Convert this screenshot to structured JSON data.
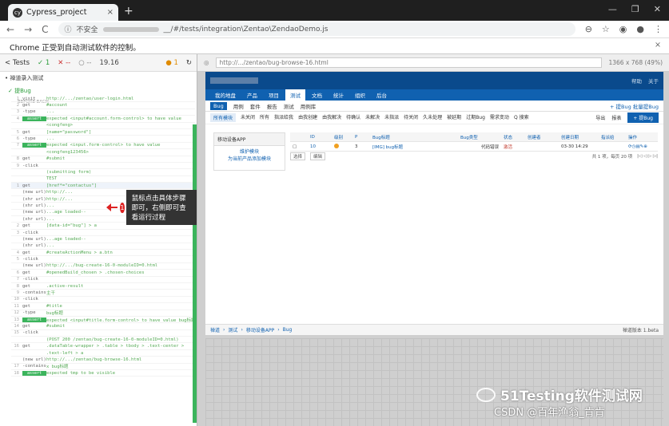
{
  "browser": {
    "tab_title": "Cypress_project",
    "new_tab": "+",
    "window_controls": [
      "—",
      "❐",
      "✕"
    ],
    "not_secure": "不安全",
    "url_path": "__/#/tests/integration\\Zentao\\ZendaoDemo.js",
    "info_bar": "Chrome 正受到自动测试软件的控制。"
  },
  "runner": {
    "tests_label": "< Tests",
    "passed": "1",
    "failed": "--",
    "pending": "--",
    "duration": "19.16",
    "count": "1"
  },
  "suite": {
    "name": "• 禅道录入测试",
    "test": "✓ 提Bug",
    "section": "BEFORE EACH"
  },
  "commands": [
    {
      "n": "1",
      "k": "visit",
      "v": "http://.../zentao/user-login.html"
    },
    {
      "n": "2",
      "k": "get",
      "v": "#account"
    },
    {
      "n": "3",
      "k": "-type",
      "v": "..."
    },
    {
      "n": "4",
      "k": "assert",
      "v": "expected <input#account.form-control> to have value"
    },
    {
      "n": "",
      "k": "",
      "v": "<congfeng>"
    },
    {
      "n": "5",
      "k": "get",
      "v": "[name=\"password\"]"
    },
    {
      "n": "6",
      "k": "-type",
      "v": "..."
    },
    {
      "n": "7",
      "k": "assert",
      "v": "expected <input.form-control> to have value"
    },
    {
      "n": "",
      "k": "",
      "v": "<congfeng123456>"
    },
    {
      "n": "8",
      "k": "get",
      "v": "#submit"
    },
    {
      "n": "9",
      "k": "-click",
      "v": ""
    },
    {
      "n": "",
      "k": "",
      "v": "(submitting form)"
    },
    {
      "n": "",
      "k": "",
      "v": "TEST"
    },
    {
      "n": "1",
      "k": "get",
      "v": "[href*=\"contactus\"]"
    },
    {
      "n": "",
      "k": "(new url)",
      "v": "http://..."
    },
    {
      "n": "",
      "k": "(xhr url)",
      "v": "http://..."
    },
    {
      "n": "",
      "k": "(xhr url)",
      "v": "..."
    },
    {
      "n": "",
      "k": "(new url)",
      "v": "...age loaded--"
    },
    {
      "n": "",
      "k": "(xhr url)",
      "v": "..."
    },
    {
      "n": "2",
      "k": "get",
      "v": "[data-id=\"bug\"] > a"
    },
    {
      "n": "3",
      "k": "-click",
      "v": ""
    },
    {
      "n": "",
      "k": "(new url)",
      "v": "...age loaded--"
    },
    {
      "n": "",
      "k": "(xhr url)",
      "v": "..."
    },
    {
      "n": "4",
      "k": "get",
      "v": "#createActionMenu > a.btn"
    },
    {
      "n": "5",
      "k": "-click",
      "v": ""
    },
    {
      "n": "",
      "k": "(new url)",
      "v": "http://.../bug-create-16-0-moduleID=0.html"
    },
    {
      "n": "6",
      "k": "get",
      "v": "#openedBuild_chosen > .chosen-choices"
    },
    {
      "n": "7",
      "k": "-click",
      "v": ""
    },
    {
      "n": "8",
      "k": "get",
      "v": ".active-result"
    },
    {
      "n": "9",
      "k": "-contains",
      "v": "主干"
    },
    {
      "n": "10",
      "k": "-click",
      "v": ""
    },
    {
      "n": "11",
      "k": "get",
      "v": "#title"
    },
    {
      "n": "12",
      "k": "-type",
      "v": "bug标题"
    },
    {
      "n": "13",
      "k": "assert",
      "v": "expected <input#title.form-control> to have value bug标题"
    },
    {
      "n": "14",
      "k": "get",
      "v": "#submit"
    },
    {
      "n": "15",
      "k": "-click",
      "v": ""
    },
    {
      "n": "",
      "k": "",
      "v": "(POST 200 /zentao/bug-create-16-0-moduleID=0.html)"
    },
    {
      "n": "16",
      "k": "get",
      "v": ".dataTable-wrapper > .table > tbody > .text-center >"
    },
    {
      "n": "",
      "k": "",
      "v": ".text-left > a"
    },
    {
      "n": "",
      "k": "(new url)",
      "v": "http://.../zentao/bug-browse-16.html"
    },
    {
      "n": "17",
      "k": "-contains",
      "v": "x bug标题"
    },
    {
      "n": "18",
      "k": "assert",
      "v": "expected tmp to be visible"
    }
  ],
  "annotation": {
    "badge": "1",
    "text": "鼠标点击具体步骤即可，右侧即可查看运行过程"
  },
  "aut": {
    "viewport": "1366 x 768  (49%)",
    "url": "http://.../zentao/bug-browse-16.html"
  },
  "zentao": {
    "header_right": [
      "帮助",
      "关于"
    ],
    "nav": [
      "我的地盘",
      "产品",
      "项目",
      "测试",
      "文档",
      "统计",
      "组织",
      "后台"
    ],
    "active_nav": "测试",
    "subnav": [
      "Bug",
      "用例",
      "套件",
      "报告",
      "测试",
      "用例库"
    ],
    "subnav_right": [
      "+ 提Bug",
      "批量提Bug"
    ],
    "filters": [
      "所有模块",
      "未关闭",
      "所有",
      "指派给我",
      "由我创建",
      "由我解决",
      "待确认",
      "未解决",
      "未指派",
      "待关闭",
      "久未处理",
      "被延期",
      "过期Bug",
      "需求变动",
      "Q 搜索"
    ],
    "export": "导出",
    "report": "报表",
    "create_btn": "+ 提Bug",
    "side_title": "移动设备APP",
    "side_links": [
      "维护模块",
      "为当前产品添加模块"
    ],
    "grid_headers": [
      "ID",
      "级别",
      "P",
      "Bug标题",
      "Bug类型",
      "状态",
      "创建者",
      "创建日期",
      "指派给",
      "操作"
    ],
    "row": {
      "id": "10",
      "level": "3",
      "p": "3",
      "title": "[IMG] bug标题",
      "type": "代码错误",
      "status": "激活",
      "date": "03-30 14:29"
    },
    "footer_select": "选择",
    "footer_edit": "编辑",
    "pagination": "共 1 项，每页 20 项",
    "breadcrumb": [
      "禅道",
      "测试",
      "移动设备APP",
      "Bug"
    ],
    "bottom_right": "禅道版本 1.beta"
  },
  "watermark": {
    "line1": "51Testing软件测试网",
    "line2": "CSDN @百年渔翁_肯肯"
  }
}
